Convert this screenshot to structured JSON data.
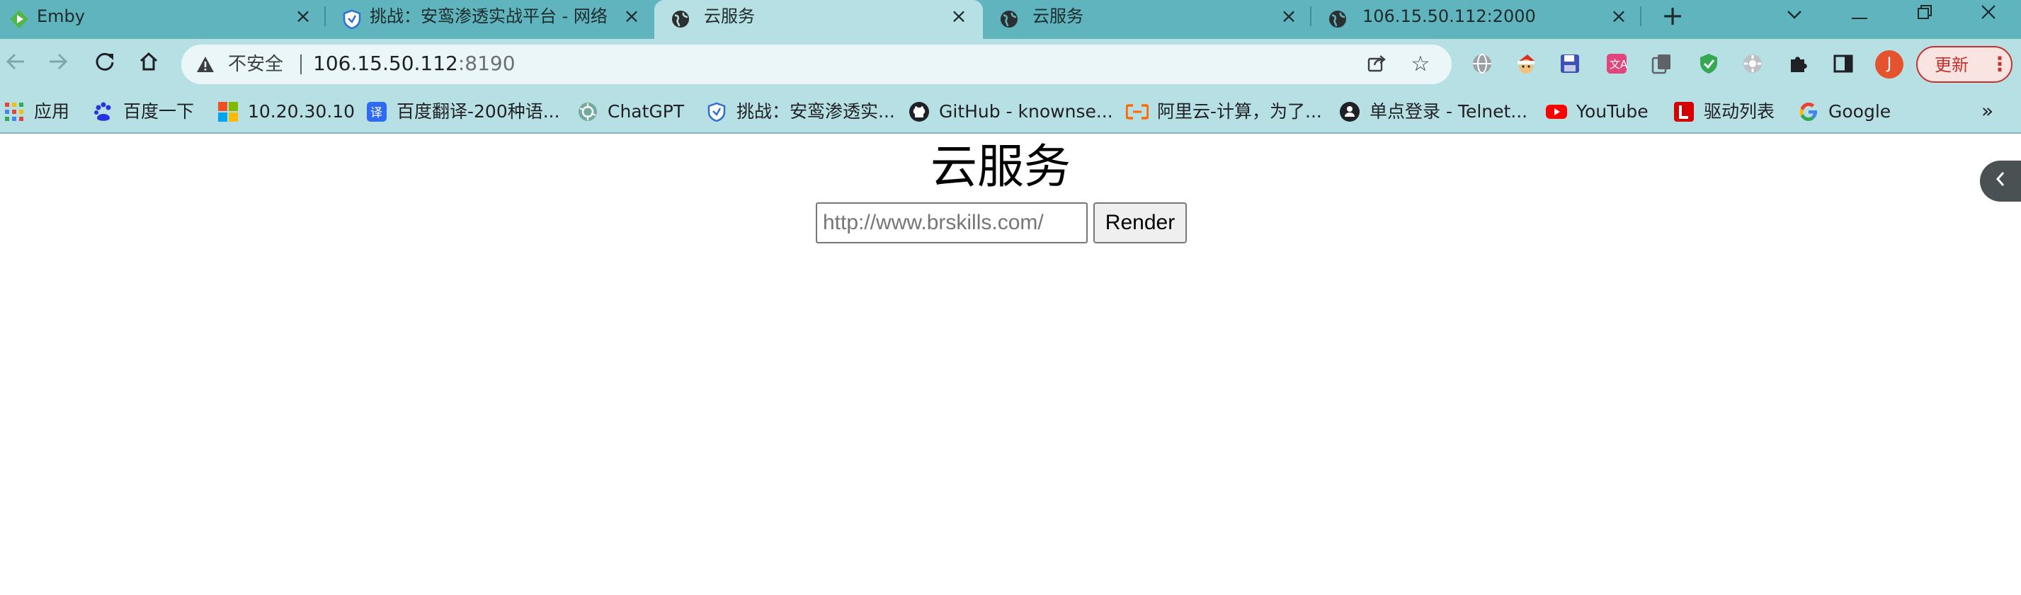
{
  "browser": {
    "tabs": [
      {
        "title": "Emby",
        "active": false
      },
      {
        "title": "挑战：安鸾渗透实战平台 - 网络",
        "active": false
      },
      {
        "title": "云服务",
        "active": true
      },
      {
        "title": "云服务",
        "active": false
      },
      {
        "title": "106.15.50.112:2000",
        "active": false
      }
    ],
    "address_bar": {
      "security_label": "不安全",
      "host": "106.15.50.112",
      "port": ":8190"
    },
    "update_button_label": "更新",
    "avatar_letter": "J",
    "bookmarks": [
      {
        "label": "应用",
        "icon": "apps-grid-icon"
      },
      {
        "label": "百度一下",
        "icon": "baidu-icon"
      },
      {
        "label": "10.20.30.10",
        "icon": "windows-icon"
      },
      {
        "label": "百度翻译-200种语...",
        "icon": "translate-icon"
      },
      {
        "label": "ChatGPT",
        "icon": "chatgpt-icon"
      },
      {
        "label": "挑战：安鸾渗透实...",
        "icon": "shield-icon"
      },
      {
        "label": "GitHub - knownse...",
        "icon": "github-icon"
      },
      {
        "label": "阿里云-计算，为了...",
        "icon": "aliyun-icon"
      },
      {
        "label": "单点登录 - Telnet...",
        "icon": "telnet-icon"
      },
      {
        "label": "YouTube",
        "icon": "youtube-icon"
      },
      {
        "label": "驱动列表",
        "icon": "l-icon"
      },
      {
        "label": "Google",
        "icon": "google-icon"
      }
    ],
    "bookmarks_overflow": "»",
    "colors": {
      "tabstrip": "#5fb4be",
      "toolbar": "#b7e0e5",
      "update_accent": "#c5312d"
    }
  },
  "page": {
    "heading": "云服务",
    "url_input": {
      "placeholder": "http://www.brskills.com/",
      "value": ""
    },
    "render_button_label": "Render"
  }
}
